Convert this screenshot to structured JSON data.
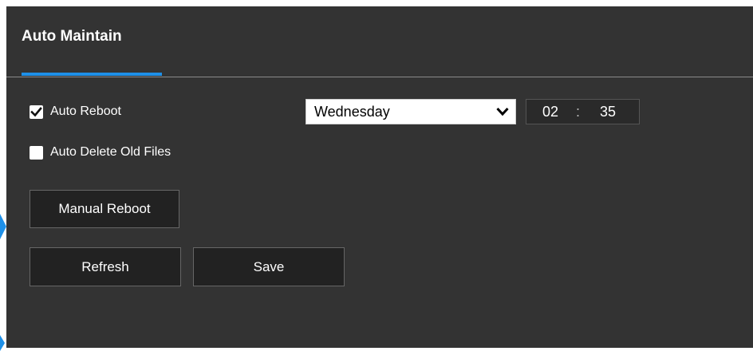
{
  "tab": {
    "title": "Auto Maintain"
  },
  "auto_reboot": {
    "label": "Auto Reboot",
    "checked": true,
    "day": "Wednesday",
    "hour": "02",
    "separator": ":",
    "minute": "35"
  },
  "auto_delete": {
    "label": "Auto Delete Old Files",
    "checked": false
  },
  "buttons": {
    "manual_reboot": "Manual Reboot",
    "refresh": "Refresh",
    "save": "Save"
  },
  "colors": {
    "accent": "#1e90e8",
    "panel_bg": "#333333",
    "button_bg": "#222222"
  }
}
